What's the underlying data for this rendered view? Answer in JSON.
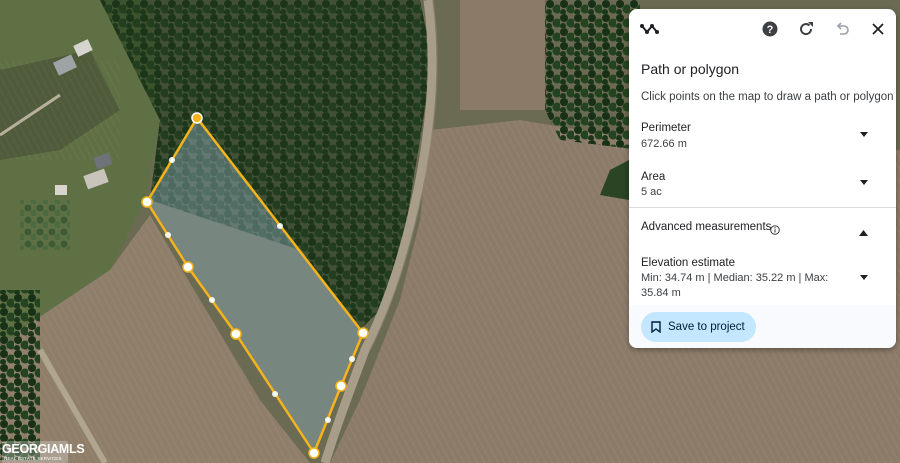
{
  "map": {
    "type": "satellite",
    "colors": {
      "field": "#8a7d68",
      "forest": "#1f3a1c",
      "road": "#a59a86",
      "polygon_stroke": "#f5b31c",
      "polygon_fill": "#8aa9b8"
    }
  },
  "panel": {
    "mode_icon": "path-squiggle-icon",
    "title": "Path or polygon",
    "description": "Click points on the map to draw a path or polygon",
    "perimeter": {
      "label": "Perimeter",
      "value": "672.66 m"
    },
    "area": {
      "label": "Area",
      "value": "5 ac"
    },
    "advanced": {
      "label": "Advanced measurements",
      "expanded": true
    },
    "elevation": {
      "label": "Elevation estimate",
      "value": "Min: 34.74 m | Median: 35.22 m | Max: 35.84 m"
    },
    "save_label": "Save to project"
  },
  "watermark": {
    "brand": "GEORGIAMLS",
    "tagline": "REAL ESTATE SERVICES"
  }
}
